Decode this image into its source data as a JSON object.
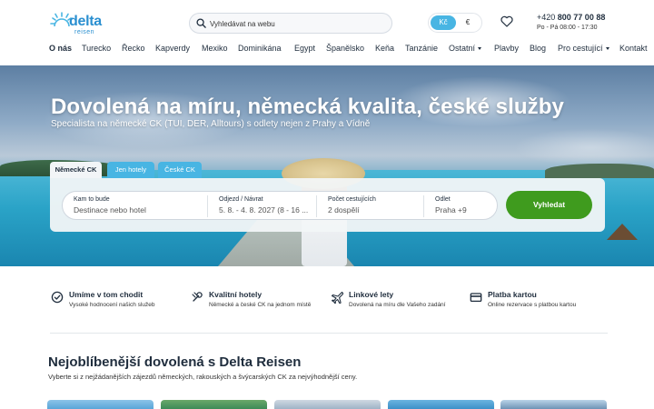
{
  "brand": {
    "name": "delta",
    "tagline": "reisen",
    "color": "#2a8fd0"
  },
  "header": {
    "search_placeholder": "Vyhledávat na webu",
    "currency": {
      "selected": "Kč",
      "options": [
        "Kč",
        "€"
      ],
      "active_color": "#48b5e3"
    },
    "phone_prefix": "+420 ",
    "phone_number": "800 77 00 88",
    "hours": "Po - Pá 08:00 - 17:30"
  },
  "nav": {
    "items": [
      {
        "label": "O nás",
        "active": true
      },
      {
        "label": "Turecko"
      },
      {
        "label": "Řecko"
      },
      {
        "label": "Kapverdy"
      },
      {
        "label": "Mexiko"
      },
      {
        "label": "Dominikána"
      },
      {
        "label": "Egypt"
      },
      {
        "label": "Španělsko"
      },
      {
        "label": "Keňa"
      },
      {
        "label": "Tanzánie"
      },
      {
        "label": "Ostatní",
        "dropdown": true
      },
      {
        "label": "Plavby"
      },
      {
        "label": "Blog"
      },
      {
        "label": "Pro cestující",
        "dropdown": true
      },
      {
        "label": "Kontakt"
      }
    ]
  },
  "hero": {
    "title": "Dovolená na míru, německá kvalita, české služby",
    "subtitle": "Specialista na německé CK (TUI, DER, Alltours) s odlety nejen z Prahy a Vídně",
    "tabs": [
      {
        "label": "Německé CK",
        "selected": true
      },
      {
        "label": "Jen hotely"
      },
      {
        "label": "České CK"
      }
    ],
    "form": {
      "destination_label": "Kam to bude",
      "destination_placeholder": "Destinace nebo hotel",
      "dates_label": "Odjezd / Návrat",
      "dates_value": "5. 8. - 4. 8. 2027 (8 - 16 ...",
      "travelers_label": "Počet cestujících",
      "travelers_value": "2 dospělí",
      "departure_label": "Odlet",
      "departure_value": "Praha +9",
      "submit_label": "Vyhledat",
      "submit_color": "#3f9b1e"
    }
  },
  "features": [
    {
      "icon": "check-circle-icon",
      "title": "Umíme v tom chodit",
      "desc": "Vysoké hodnocení našich služeb"
    },
    {
      "icon": "quality-seal-icon",
      "title": "Kvalitní hotely",
      "desc": "Německé a české CK na jednom místě"
    },
    {
      "icon": "airplane-icon",
      "title": "Linkové lety",
      "desc": "Dovolená na míru dle Vašeho zadání"
    },
    {
      "icon": "credit-card-icon",
      "title": "Platba kartou",
      "desc": "Online rezervace s platbou kartou"
    }
  ],
  "popular": {
    "title": "Nejoblíbenější dovolená s Delta Reisen",
    "subtitle": "Vyberte si z nejžádanějších zájezdů německých, rakouských a švýcarských CK za nejvýhodnější ceny."
  }
}
